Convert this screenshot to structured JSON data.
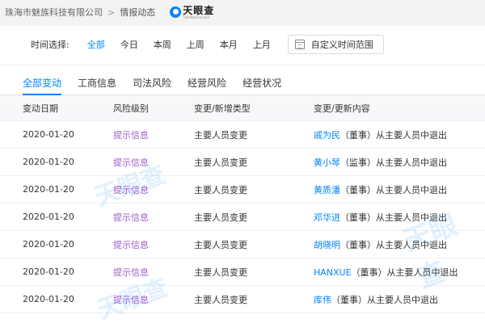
{
  "breadcrumb": {
    "company": "珠海市魅族科技有限公司",
    "separator": ">",
    "current": "情报动态"
  },
  "logo": {
    "name": "天眼查",
    "url": "TianYanCha.com"
  },
  "filter": {
    "label": "时间选择:",
    "options": [
      "全部",
      "今日",
      "本周",
      "上周",
      "本月",
      "上月"
    ],
    "selected": "全部",
    "custom_range": "自定义时间范围"
  },
  "tabs": [
    "全部变动",
    "工商信息",
    "司法风险",
    "经营风险",
    "经营状况"
  ],
  "active_tab": "全部变动",
  "table": {
    "headers": [
      "变动日期",
      "风险级别",
      "变更/新增类型",
      "变更/更新内容"
    ],
    "rows": [
      {
        "date": "2020-01-20",
        "risk": "提示信息",
        "type": "主要人员变更",
        "person": "戚为民",
        "detail": "（董事）从主要人员中退出"
      },
      {
        "date": "2020-01-20",
        "risk": "提示信息",
        "type": "主要人员变更",
        "person": "黄小琴",
        "detail": "（监事）从主要人员中退出"
      },
      {
        "date": "2020-01-20",
        "risk": "提示信息",
        "type": "主要人员变更",
        "person": "黄质潘",
        "detail": "（董事）从主要人员中退出"
      },
      {
        "date": "2020-01-20",
        "risk": "提示信息",
        "type": "主要人员变更",
        "person": "邓华进",
        "detail": "（董事）从主要人员中退出"
      },
      {
        "date": "2020-01-20",
        "risk": "提示信息",
        "type": "主要人员变更",
        "person": "胡晓明",
        "detail": "（董事）从主要人员中退出"
      },
      {
        "date": "2020-01-20",
        "risk": "提示信息",
        "type": "主要人员变更",
        "person": "HANXUE",
        "detail": "（董事）从主要人员中退出"
      },
      {
        "date": "2020-01-20",
        "risk": "提示信息",
        "type": "主要人员变更",
        "person": "库伟",
        "detail": "（董事）从主要人员中退出"
      }
    ]
  },
  "watermark": "天眼查",
  "colors": {
    "accent": "#0084ff",
    "risk": "#a05ac8",
    "background": "#f3f3f3"
  }
}
